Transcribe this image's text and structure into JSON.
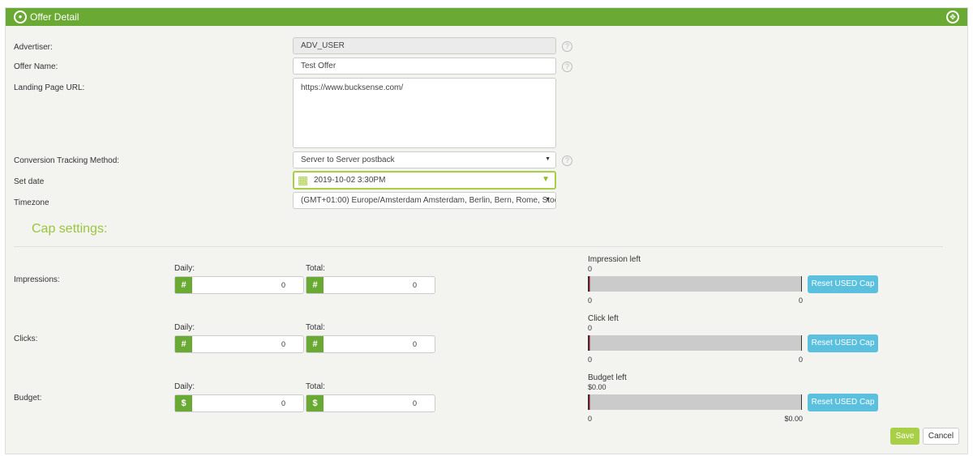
{
  "header": {
    "title": "Offer Detail"
  },
  "form": {
    "advertiser_label": "Advertiser:",
    "advertiser_value": "ADV_USER",
    "offer_name_label": "Offer Name:",
    "offer_name_value": "Test Offer",
    "url_label": "Landing Page URL:",
    "url_value": "https://www.bucksense.com/",
    "conversion_label": "Conversion Tracking Method:",
    "conversion_value": "Server to Server postback",
    "date_label": "Set date",
    "date_value": "2019-10-02 3:30PM",
    "timezone_label": "Timezone",
    "timezone_value": "(GMT+01:00) Europe/Amsterdam Amsterdam, Berlin, Bern, Rome, Stoc",
    "help": "?"
  },
  "cap": {
    "title": "Cap settings:",
    "daily": "Daily:",
    "total": "Total:",
    "reset": "Reset USED Cap",
    "rows": [
      {
        "label": "Impressions:",
        "addon": "#",
        "daily": "0",
        "total": "0",
        "left_label": "Impression left",
        "left_value": "0",
        "min": "0",
        "max": "0"
      },
      {
        "label": "Clicks:",
        "addon": "#",
        "daily": "0",
        "total": "0",
        "left_label": "Click left",
        "left_value": "0",
        "min": "0",
        "max": "0"
      },
      {
        "label": "Budget:",
        "addon": "$",
        "daily": "0",
        "total": "0",
        "left_label": "Budget left",
        "left_value": "$0.00",
        "min": "0",
        "max": "$0.00"
      }
    ]
  },
  "actions": {
    "save": "Save",
    "cancel": "Cancel"
  }
}
